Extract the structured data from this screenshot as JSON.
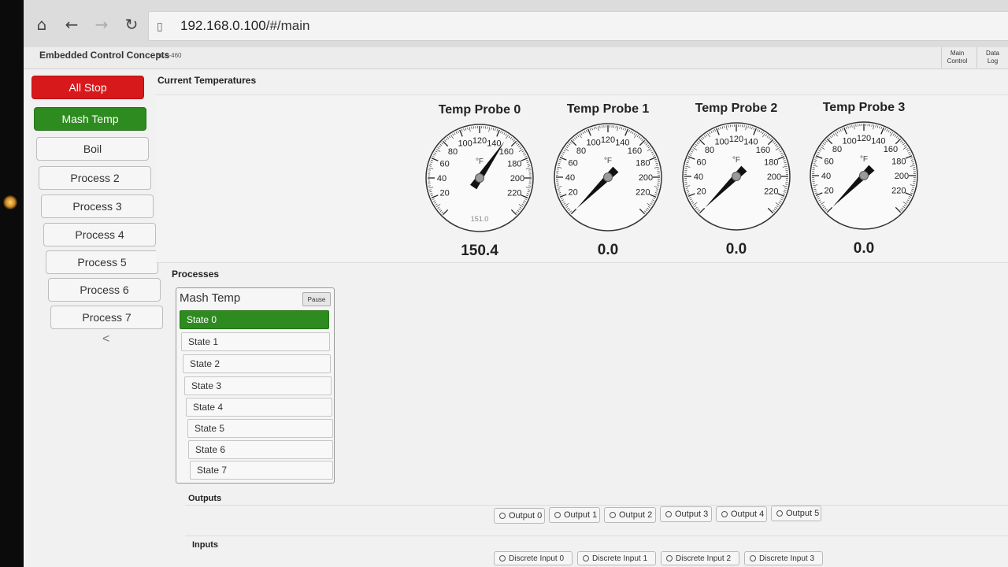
{
  "browser": {
    "url_host": "192.168.0.100",
    "url_path": "/#/main"
  },
  "header": {
    "title": "Embedded Control Concepts",
    "model": "BCS-460",
    "tabs": [
      {
        "line1": "Main",
        "line2": "Control"
      },
      {
        "line1": "Data",
        "line2": "Log"
      }
    ]
  },
  "sidebar": {
    "items": [
      {
        "label": "All Stop"
      },
      {
        "label": "Mash Temp"
      },
      {
        "label": "Boil"
      },
      {
        "label": "Process 2"
      },
      {
        "label": "Process 3"
      },
      {
        "label": "Process 4"
      },
      {
        "label": "Process 5"
      },
      {
        "label": "Process 6"
      },
      {
        "label": "Process 7"
      }
    ],
    "collapse_glyph": "<"
  },
  "temperatures": {
    "title": "Current Temperatures",
    "unit": "°F",
    "scale_min": 0,
    "scale_max": 240,
    "tick_labels": [
      "20",
      "40",
      "60",
      "80",
      "100",
      "120",
      "140",
      "160",
      "180",
      "200",
      "220"
    ],
    "probes": [
      {
        "name": "Temp Probe 0",
        "value": "150.4",
        "reading": 150.4,
        "setpoint": "151.0"
      },
      {
        "name": "Temp Probe 1",
        "value": "0.0",
        "reading": 0
      },
      {
        "name": "Temp Probe 2",
        "value": "0.0",
        "reading": 0
      },
      {
        "name": "Temp Probe 3",
        "value": "0.0",
        "reading": 0
      }
    ]
  },
  "processes": {
    "title": "Processes",
    "current": {
      "name": "Mash Temp",
      "pause_label": "Pause",
      "states": [
        "State 0",
        "State 1",
        "State 2",
        "State 3",
        "State 4",
        "State 5",
        "State 6",
        "State 7"
      ],
      "active_state": 0
    }
  },
  "outputs": {
    "title": "Outputs",
    "items": [
      "Output 0",
      "Output 1",
      "Output 2",
      "Output 3",
      "Output 4",
      "Output 5"
    ]
  },
  "inputs": {
    "title": "Inputs",
    "items": [
      "Discrete Input 0",
      "Discrete Input 1",
      "Discrete Input 2",
      "Discrete Input 3"
    ]
  },
  "colors": {
    "stop": "#d7191c",
    "active": "#2e8b1f"
  }
}
